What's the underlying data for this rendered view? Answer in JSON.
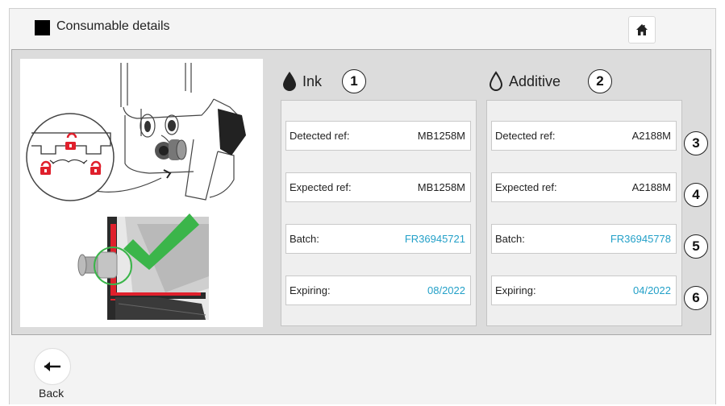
{
  "header": {
    "title": "Consumable details"
  },
  "icons": {
    "home": "home-icon",
    "back": "arrow-left-icon",
    "ink": "drop-filled-icon",
    "additive": "drop-outline-icon"
  },
  "ink": {
    "title": "Ink",
    "badge": "1",
    "fields": [
      {
        "label": "Detected ref:",
        "value": "MB1258M"
      },
      {
        "label": "Expected ref:",
        "value": "MB1258M"
      },
      {
        "label": "Batch:",
        "value": "FR36945721"
      },
      {
        "label": "Expiring:",
        "value": "08/2022"
      }
    ]
  },
  "additive": {
    "title": "Additive",
    "badge": "2",
    "fields": [
      {
        "label": "Detected ref:",
        "value": "A2188M"
      },
      {
        "label": "Expected ref:",
        "value": "A2188M"
      },
      {
        "label": "Batch:",
        "value": "FR36945778"
      },
      {
        "label": "Expiring:",
        "value": "04/2022"
      }
    ]
  },
  "row_badges": [
    "3",
    "4",
    "5",
    "6"
  ],
  "footer": {
    "back_label": "Back"
  },
  "colors": {
    "accent_blue": "#23a0c8",
    "lock_red": "#e0202c",
    "check_green": "#3bb54a"
  }
}
